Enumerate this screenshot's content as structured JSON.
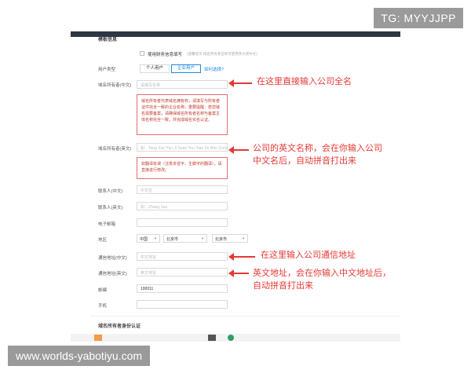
{
  "watermarks": {
    "top_right": "TG: MYYJJPP",
    "bottom_left": "www.worlds-yabotiyu.com"
  },
  "form": {
    "section_title": "模板信息",
    "use_existing": {
      "label": "使用财务信息填写",
      "hint": "(温馨提示:域名所有者名称可使用英文或中文)"
    },
    "user_type": {
      "label": "用户类型",
      "options": [
        "个人用户",
        "企业用户"
      ],
      "selected": "企业用户",
      "help_link": "如何选择?"
    },
    "owner_cn": {
      "label": "域名所有者(中文)",
      "placeholder": "请填写名称"
    },
    "owner_cn_note": "域名所有者代表域名拥有权，请填写与所有者证件完全一致的企业名称。重要提醒：若您域名需要备案，请确保域名所有者名称与备案主体名称完全一致，并完成域名实名认证。",
    "owner_en": {
      "label": "域名所有者(英文)",
      "placeholder": "如：Tang Xun Yun Ji Suan You Xian Ze Ren Gong Si"
    },
    "owner_en_note": "如翻译有误（注意多音字、生僻字的翻译），请直接进行修改。",
    "contact_cn": {
      "label": "联系人(中文)",
      "placeholder": "中文名"
    },
    "contact_en": {
      "label": "联系人(英文)",
      "placeholder": "如：Zhang San"
    },
    "email": {
      "label": "电子邮箱",
      "placeholder": ""
    },
    "region": {
      "label": "地区",
      "country": "中国",
      "province": "北京市",
      "city": "北京市"
    },
    "address_cn": {
      "label": "通信地址(中文)",
      "placeholder": "中文地址"
    },
    "address_en": {
      "label": "通信地址(英文)",
      "placeholder": "英文地址"
    },
    "postcode": {
      "label": "邮编",
      "value": "100011"
    },
    "phone": {
      "label": "手机",
      "placeholder": ""
    },
    "verify_title": "域名所有者身份认证"
  },
  "annotations": {
    "a1": [
      "在这里直接输入公司全名"
    ],
    "a2": [
      "公司的英文名称，会在你输入公司",
      "中文名后，自动拼音打出来"
    ],
    "a3": [
      "在这里输入公司通信地址"
    ],
    "a4": [
      "英文地址，会在你输入中文地址后，",
      "自动拼音打出来"
    ]
  },
  "colors": {
    "annotation": "#e53935",
    "accent": "#1e88e5",
    "note_border": "#e36d6d"
  }
}
